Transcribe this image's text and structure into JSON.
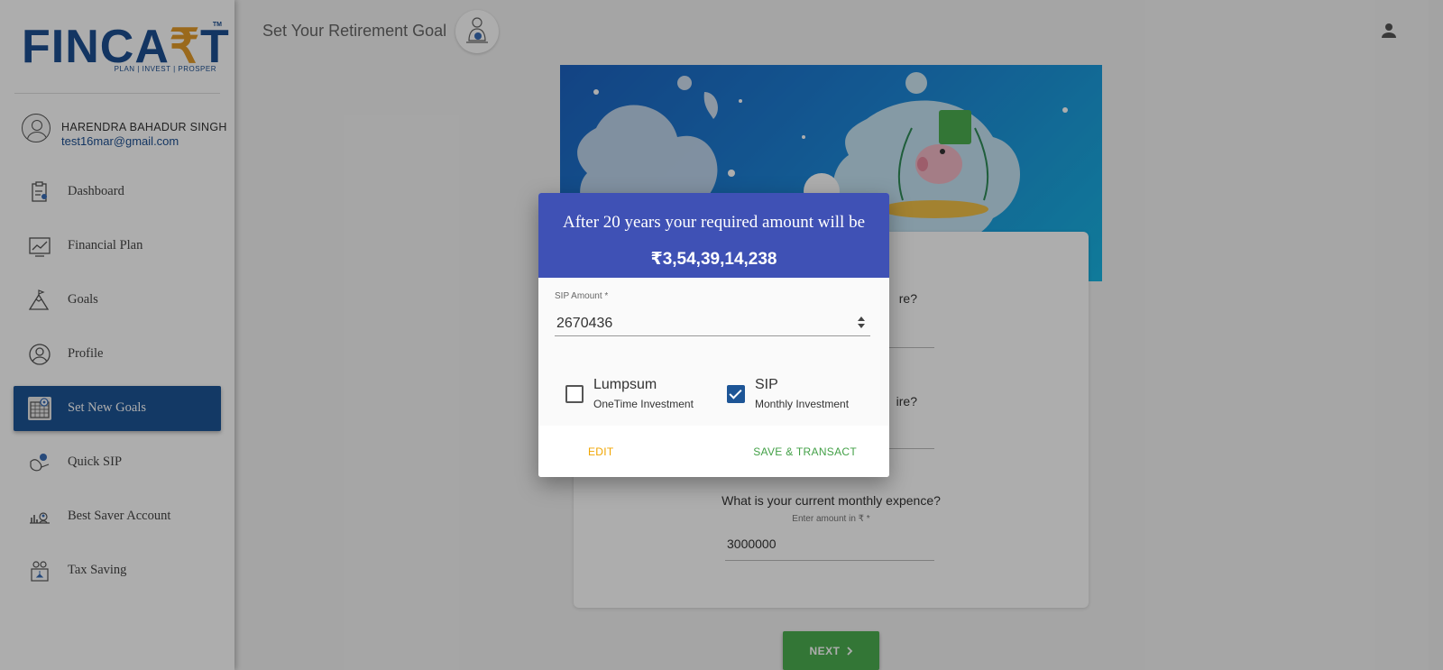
{
  "app": {
    "logo": {
      "brand": "FINCART",
      "tagline": "PLAN | INVEST | PROSPER",
      "tm": "TM"
    },
    "page_title": "Set Your Retirement Goal"
  },
  "user": {
    "name": "HARENDRA BAHADUR SINGH",
    "email": "test16mar@gmail.com"
  },
  "sidebar": {
    "items": [
      {
        "label": "Dashboard",
        "icon": "dashboard-icon",
        "active": false
      },
      {
        "label": "Financial Plan",
        "icon": "chart-icon",
        "active": false
      },
      {
        "label": "Goals",
        "icon": "mountain-flag-icon",
        "active": false
      },
      {
        "label": "Profile",
        "icon": "profile-icon",
        "active": false
      },
      {
        "label": "Set New Goals",
        "icon": "goal-target-icon",
        "active": true
      },
      {
        "label": "Quick SIP",
        "icon": "quick-sip-icon",
        "active": false
      },
      {
        "label": "Best Saver Account",
        "icon": "saver-icon",
        "active": false
      },
      {
        "label": "Tax Saving",
        "icon": "tax-saving-icon",
        "active": false
      }
    ]
  },
  "form": {
    "q3": {
      "question": "What is your current monthly expence?",
      "sub_label": "Enter amount in ₹ *",
      "value": "3000000"
    },
    "partial_q1_tail": "re?",
    "partial_q2_tail": "ire?",
    "next_label": "NEXT"
  },
  "dialog": {
    "title": "After 20 years your required amount will be",
    "amount": "₹3,54,39,14,238",
    "sip_label": "SIP Amount *",
    "sip_value": "2670436",
    "options": [
      {
        "label": "Lumpsum",
        "sub": "OneTime Investment",
        "checked": false
      },
      {
        "label": "SIP",
        "sub": "Monthly Investment",
        "checked": true
      }
    ],
    "edit_label": "EDIT",
    "save_label": "SAVE & TRANSACT"
  },
  "colors": {
    "brand": "#1d4f91",
    "accent": "#e39b2a",
    "dialog_header": "#3f51b5",
    "sidebar_active": "#1d5596",
    "next_button": "#4caf50",
    "edit_button": "#f0a500",
    "save_button": "#43a047"
  }
}
